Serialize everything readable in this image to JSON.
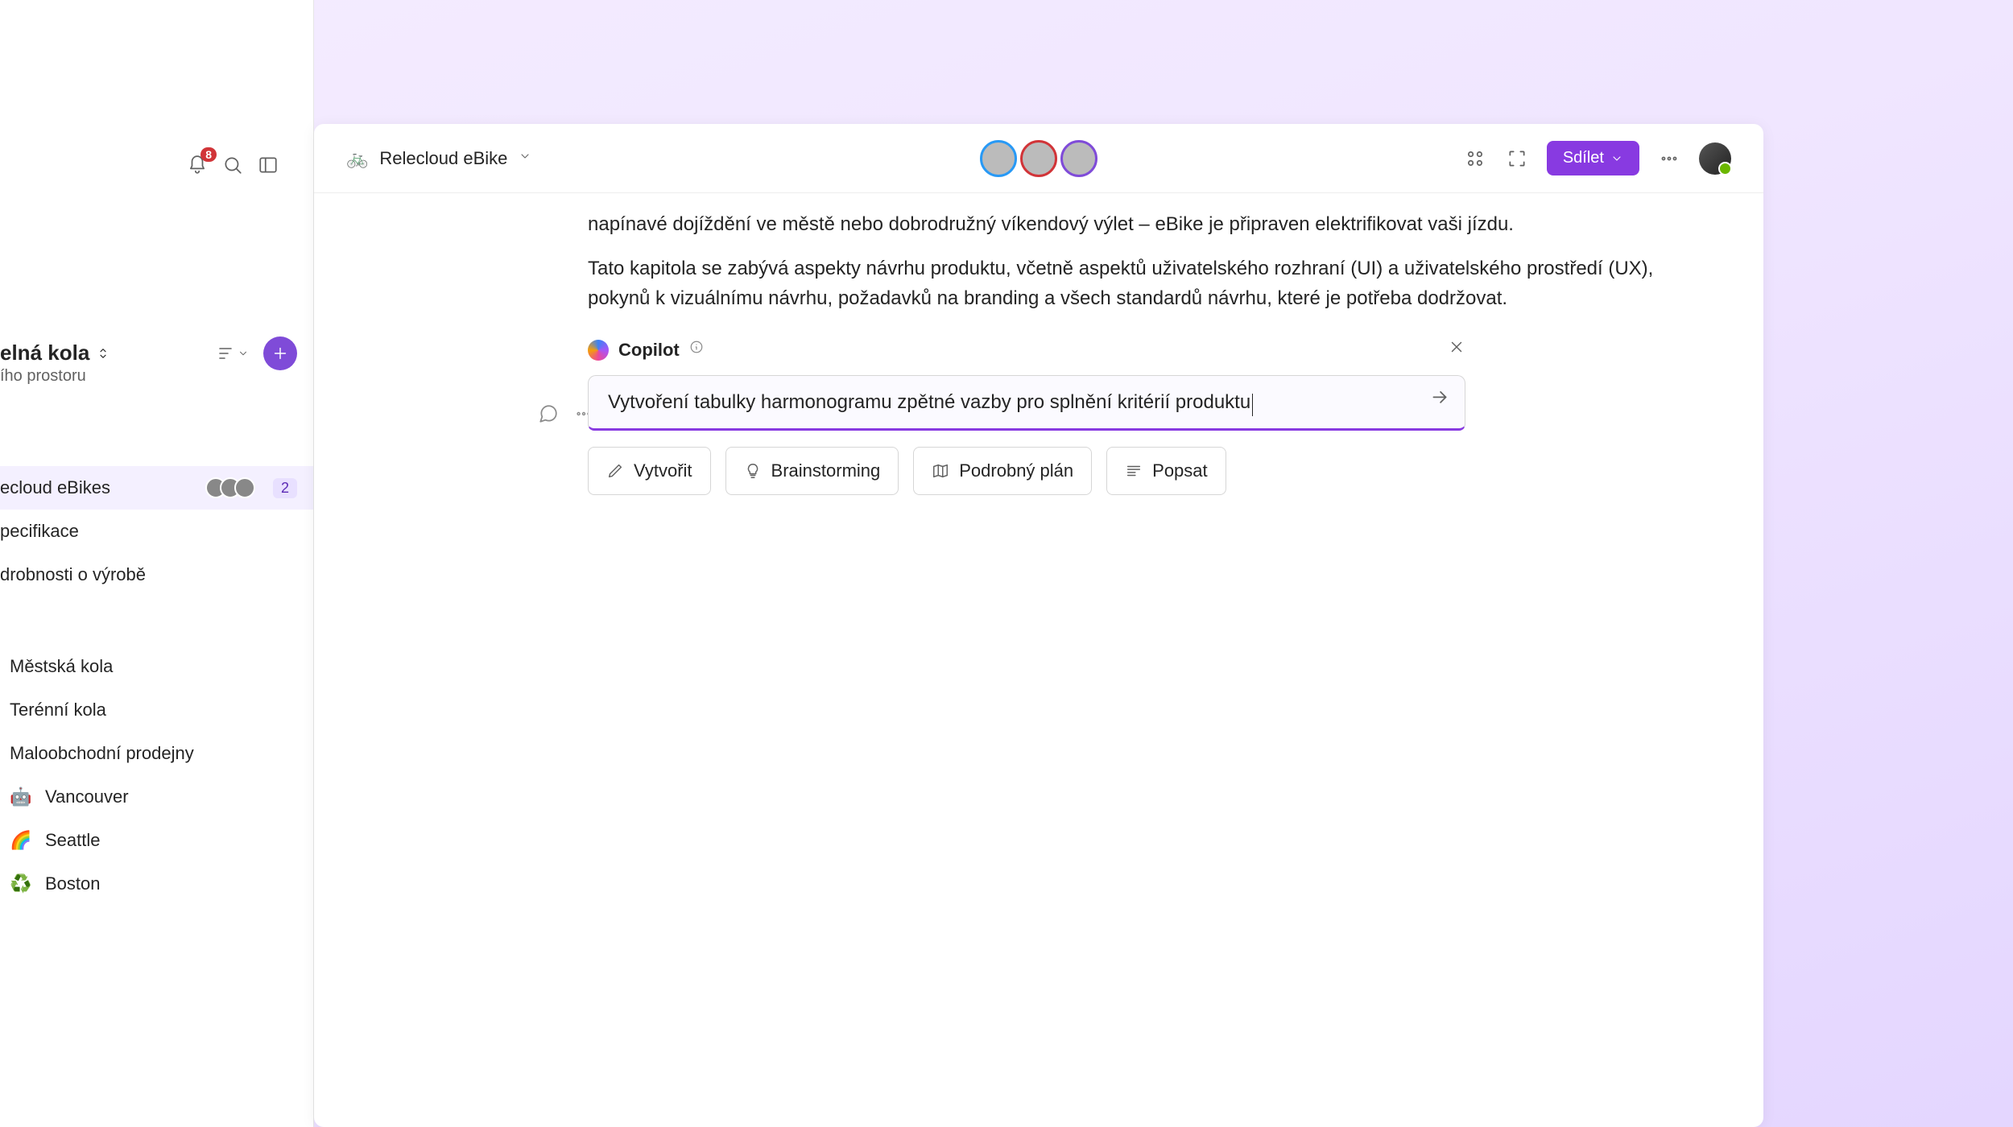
{
  "sidebar": {
    "notification_count": "8",
    "workspace_title": "elná kola",
    "workspace_subtitle": "ího prostoru",
    "pages": [
      {
        "label": "ecloud eBikes",
        "active": true,
        "badge": "2",
        "avatars": 3
      },
      {
        "label": "pecifikace"
      },
      {
        "label": "drobnosti o výrobě"
      }
    ],
    "subpages": [
      {
        "label": "Městská kola"
      },
      {
        "label": "Terénní kola"
      },
      {
        "label": "Maloobchodní prodejny"
      }
    ],
    "cities": [
      {
        "emoji": "🤖",
        "label": "Vancouver"
      },
      {
        "emoji": "🌈",
        "label": "Seattle"
      },
      {
        "emoji": "♻️",
        "label": "Boston"
      }
    ]
  },
  "document": {
    "title": "Relecloud eBike",
    "bike_emoji": "🚲",
    "share_label": "Sdílet",
    "paragraph1": "napínavé dojíždění ve městě nebo dobrodružný víkendový výlet – eBike je připraven elektrifikovat vaši jízdu.",
    "paragraph2": "Tato kapitola se zabývá aspekty návrhu produktu, včetně aspektů uživatelského rozhraní (UI) a uživatelského prostředí (UX), pokynů k vizuálnímu návrhu, požadavků na branding a všech standardů návrhu, které je potřeba dodržovat."
  },
  "copilot": {
    "name": "Copilot",
    "prompt": "Vytvoření tabulky harmonogramu zpětné vazby pro splnění kritérií produktu",
    "chips": [
      {
        "label": "Vytvořit",
        "icon": "pen"
      },
      {
        "label": "Brainstorming",
        "icon": "bulb"
      },
      {
        "label": "Podrobný plán",
        "icon": "map"
      },
      {
        "label": "Popsat",
        "icon": "lines"
      }
    ]
  }
}
